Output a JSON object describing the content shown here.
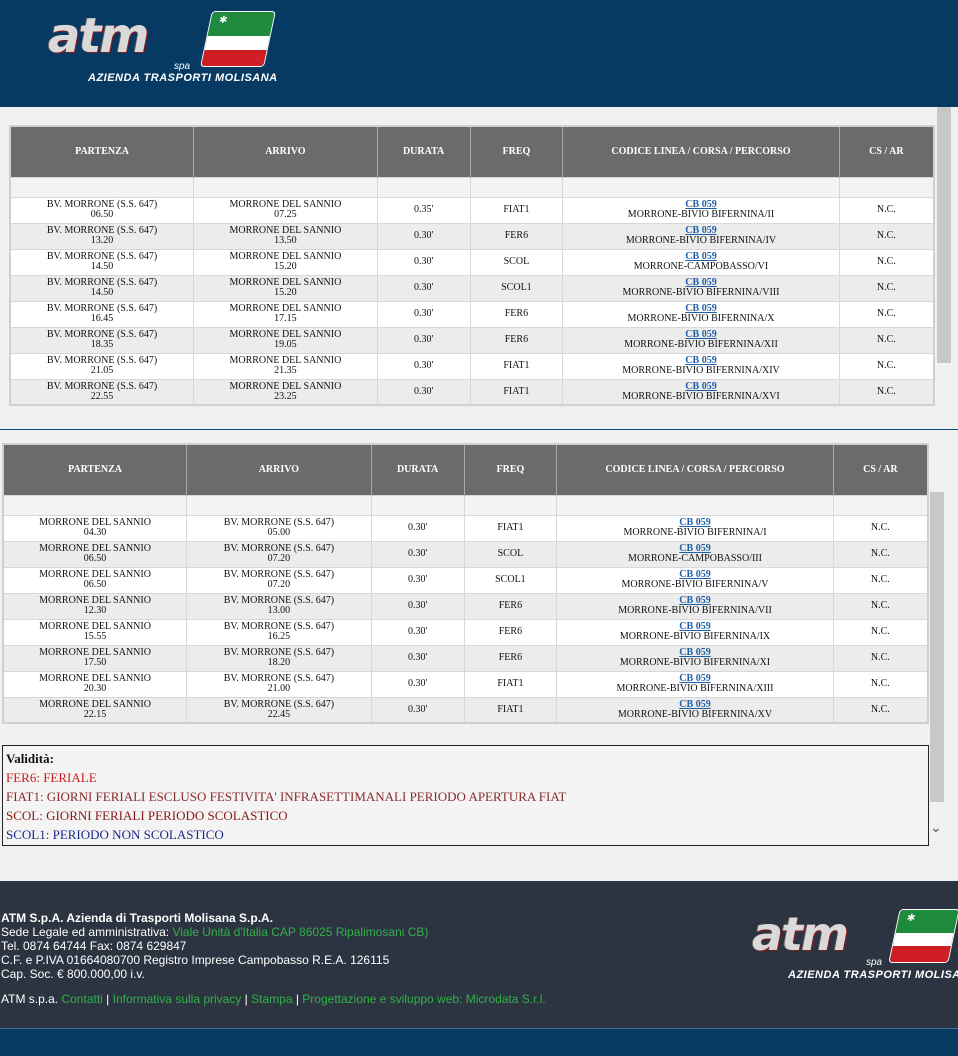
{
  "brand": {
    "logo_text": "atm",
    "logo_spa": "spa",
    "tagline": "AZIENDA TRASPORTI MOLISANA"
  },
  "icons": {
    "scroll_down": "chevron-down-icon",
    "flag": "italian-flag-icon"
  },
  "colors": {
    "header_bg": "#063a63",
    "footer_bg": "#2b3440",
    "table_header_bg": "#6b6b6b",
    "link": "#1f5fa8",
    "footer_link": "#33b04a"
  },
  "columns": [
    "PARTENZA",
    "ARRIVO",
    "DURATA",
    "FREQ",
    "CODICE LINEA / CORSA / PERCORSO",
    "CS / AR"
  ],
  "table1": {
    "rows": [
      {
        "from": "BV. MORRONE (S.S. 647)",
        "dep": "06.50",
        "to": "MORRONE DEL SANNIO",
        "arr": "07.25",
        "dur": "0.35'",
        "freq": "FIAT1",
        "code": "CB 059",
        "route": "MORRONE-BIVIO BIFERNINA/II",
        "cs": "N.C."
      },
      {
        "from": "BV. MORRONE (S.S. 647)",
        "dep": "13.20",
        "to": "MORRONE DEL SANNIO",
        "arr": "13.50",
        "dur": "0.30'",
        "freq": "FER6",
        "code": "CB 059",
        "route": "MORRONE-BIVIO BIFERNINA/IV",
        "cs": "N.C."
      },
      {
        "from": "BV. MORRONE (S.S. 647)",
        "dep": "14.50",
        "to": "MORRONE DEL SANNIO",
        "arr": "15.20",
        "dur": "0.30'",
        "freq": "SCOL",
        "code": "CB 059",
        "route": "MORRONE-CAMPOBASSO/VI",
        "cs": "N.C."
      },
      {
        "from": "BV. MORRONE (S.S. 647)",
        "dep": "14.50",
        "to": "MORRONE DEL SANNIO",
        "arr": "15.20",
        "dur": "0.30'",
        "freq": "SCOL1",
        "code": "CB 059",
        "route": "MORRONE-BIVIO BIFERNINA/VIII",
        "cs": "N.C."
      },
      {
        "from": "BV. MORRONE (S.S. 647)",
        "dep": "16.45",
        "to": "MORRONE DEL SANNIO",
        "arr": "17.15",
        "dur": "0.30'",
        "freq": "FER6",
        "code": "CB 059",
        "route": "MORRONE-BIVIO BIFERNINA/X",
        "cs": "N.C."
      },
      {
        "from": "BV. MORRONE (S.S. 647)",
        "dep": "18.35",
        "to": "MORRONE DEL SANNIO",
        "arr": "19.05",
        "dur": "0.30'",
        "freq": "FER6",
        "code": "CB 059",
        "route": "MORRONE-BIVIO BIFERNINA/XII",
        "cs": "N.C."
      },
      {
        "from": "BV. MORRONE (S.S. 647)",
        "dep": "21.05",
        "to": "MORRONE DEL SANNIO",
        "arr": "21.35",
        "dur": "0.30'",
        "freq": "FIAT1",
        "code": "CB 059",
        "route": "MORRONE-BIVIO BIFERNINA/XIV",
        "cs": "N.C."
      },
      {
        "from": "BV. MORRONE (S.S. 647)",
        "dep": "22.55",
        "to": "MORRONE DEL SANNIO",
        "arr": "23.25",
        "dur": "0.30'",
        "freq": "FIAT1",
        "code": "CB 059",
        "route": "MORRONE-BIVIO BIFERNINA/XVI",
        "cs": "N.C."
      }
    ]
  },
  "table2": {
    "rows": [
      {
        "from": "MORRONE DEL SANNIO",
        "dep": "04.30",
        "to": "BV. MORRONE (S.S. 647)",
        "arr": "05.00",
        "dur": "0.30'",
        "freq": "FIAT1",
        "code": "CB 059",
        "route": "MORRONE-BIVIO BIFERNINA/I",
        "cs": "N.C."
      },
      {
        "from": "MORRONE DEL SANNIO",
        "dep": "06.50",
        "to": "BV. MORRONE (S.S. 647)",
        "arr": "07.20",
        "dur": "0.30'",
        "freq": "SCOL",
        "code": "CB 059",
        "route": "MORRONE-CAMPOBASSO/III",
        "cs": "N.C."
      },
      {
        "from": "MORRONE DEL SANNIO",
        "dep": "06.50",
        "to": "BV. MORRONE (S.S. 647)",
        "arr": "07.20",
        "dur": "0.30'",
        "freq": "SCOL1",
        "code": "CB 059",
        "route": "MORRONE-BIVIO BIFERNINA/V",
        "cs": "N.C."
      },
      {
        "from": "MORRONE DEL SANNIO",
        "dep": "12.30",
        "to": "BV. MORRONE (S.S. 647)",
        "arr": "13.00",
        "dur": "0.30'",
        "freq": "FER6",
        "code": "CB 059",
        "route": "MORRONE-BIVIO BIFERNINA/VII",
        "cs": "N.C."
      },
      {
        "from": "MORRONE DEL SANNIO",
        "dep": "15.55",
        "to": "BV. MORRONE (S.S. 647)",
        "arr": "16.25",
        "dur": "0.30'",
        "freq": "FER6",
        "code": "CB 059",
        "route": "MORRONE-BIVIO BIFERNINA/IX",
        "cs": "N.C."
      },
      {
        "from": "MORRONE DEL SANNIO",
        "dep": "17.50",
        "to": "BV. MORRONE (S.S. 647)",
        "arr": "18.20",
        "dur": "0.30'",
        "freq": "FER6",
        "code": "CB 059",
        "route": "MORRONE-BIVIO BIFERNINA/XI",
        "cs": "N.C."
      },
      {
        "from": "MORRONE DEL SANNIO",
        "dep": "20.30",
        "to": "BV. MORRONE (S.S. 647)",
        "arr": "21.00",
        "dur": "0.30'",
        "freq": "FIAT1",
        "code": "CB 059",
        "route": "MORRONE-BIVIO BIFERNINA/XIII",
        "cs": "N.C."
      },
      {
        "from": "MORRONE DEL SANNIO",
        "dep": "22.15",
        "to": "BV. MORRONE (S.S. 647)",
        "arr": "22.45",
        "dur": "0.30'",
        "freq": "FIAT1",
        "code": "CB 059",
        "route": "MORRONE-BIVIO BIFERNINA/XV",
        "cs": "N.C."
      }
    ]
  },
  "validity": {
    "title": "Validità:",
    "items": [
      {
        "text": "FER6: FERIALE",
        "color": "#d11a1a"
      },
      {
        "text": "FIAT1: GIORNI FERIALI ESCLUSO FESTIVITA' INFRASETTIMANALI PERIODO APERTURA FIAT",
        "color": "#8a2a2a"
      },
      {
        "text": "SCOL: GIORNI FERIALI PERIODO SCOLASTICO",
        "color": "#8a1818"
      },
      {
        "text": "SCOL1: PERIODO NON SCOLASTICO",
        "color": "#1a2a8a"
      }
    ]
  },
  "footer": {
    "company": "ATM S.p.A. Azienda di Trasporti Molisana S.p.A.",
    "seat_label": "Sede Legale ed amministrativa: ",
    "seat_address": "Viale Unità d'Italia CAP 86025 Ripalimosani CB)",
    "phone": "Tel. 0874 64744   Fax: 0874 629847",
    "vat": "C.F. e P.IVA 01664080700 Registro Imprese Campobasso R.E.A. 126115",
    "capital": "Cap. Soc. € 800.000,00 i.v.",
    "links_prefix": "ATM s.p.a. ",
    "links": [
      "Contatti",
      "Informativa sulla privacy",
      "Stampa",
      "Progettazione e sviluppo web: Microdata S.r.l."
    ],
    "separator": " | "
  }
}
